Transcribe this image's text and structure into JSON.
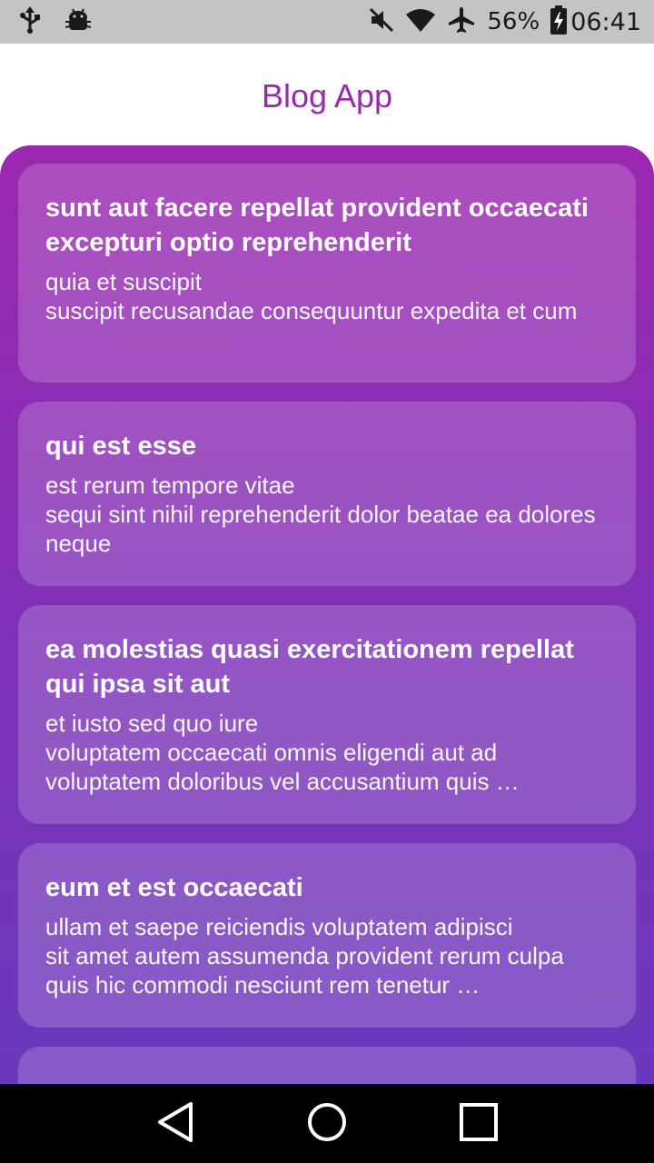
{
  "status_bar": {
    "icons_left": [
      "usb-icon",
      "android-debug-icon"
    ],
    "icons_right": [
      "mute-icon",
      "wifi-icon",
      "airplane-icon",
      "battery-charging-icon"
    ],
    "battery": "56%",
    "time": "06:41"
  },
  "app_bar": {
    "title": "Blog App"
  },
  "colors": {
    "accent": "#9c27b0",
    "gradient_top": "#9c27b0",
    "gradient_bottom": "#6a38bc"
  },
  "posts": [
    {
      "title": "sunt aut facere repellat provident occaecati excepturi optio reprehenderit",
      "body": "quia et suscipit\nsuscipit recusandae consequuntur expedita et cum"
    },
    {
      "title": "qui est esse",
      "body": "est rerum tempore vitae\nsequi sint nihil reprehenderit dolor beatae ea dolores neque"
    },
    {
      "title": "ea molestias quasi exercitationem repellat qui ipsa sit aut",
      "body": "et iusto sed quo iure\nvoluptatem occaecati omnis eligendi aut ad\nvoluptatem doloribus vel accusantium quis …"
    },
    {
      "title": "eum et est occaecati",
      "body": "ullam et saepe reiciendis voluptatem adipisci\nsit amet autem assumenda provident rerum culpa\nquis hic commodi nesciunt rem tenetur …"
    }
  ],
  "nav_bar": {
    "buttons": [
      "back-icon",
      "home-icon",
      "recents-icon"
    ]
  }
}
